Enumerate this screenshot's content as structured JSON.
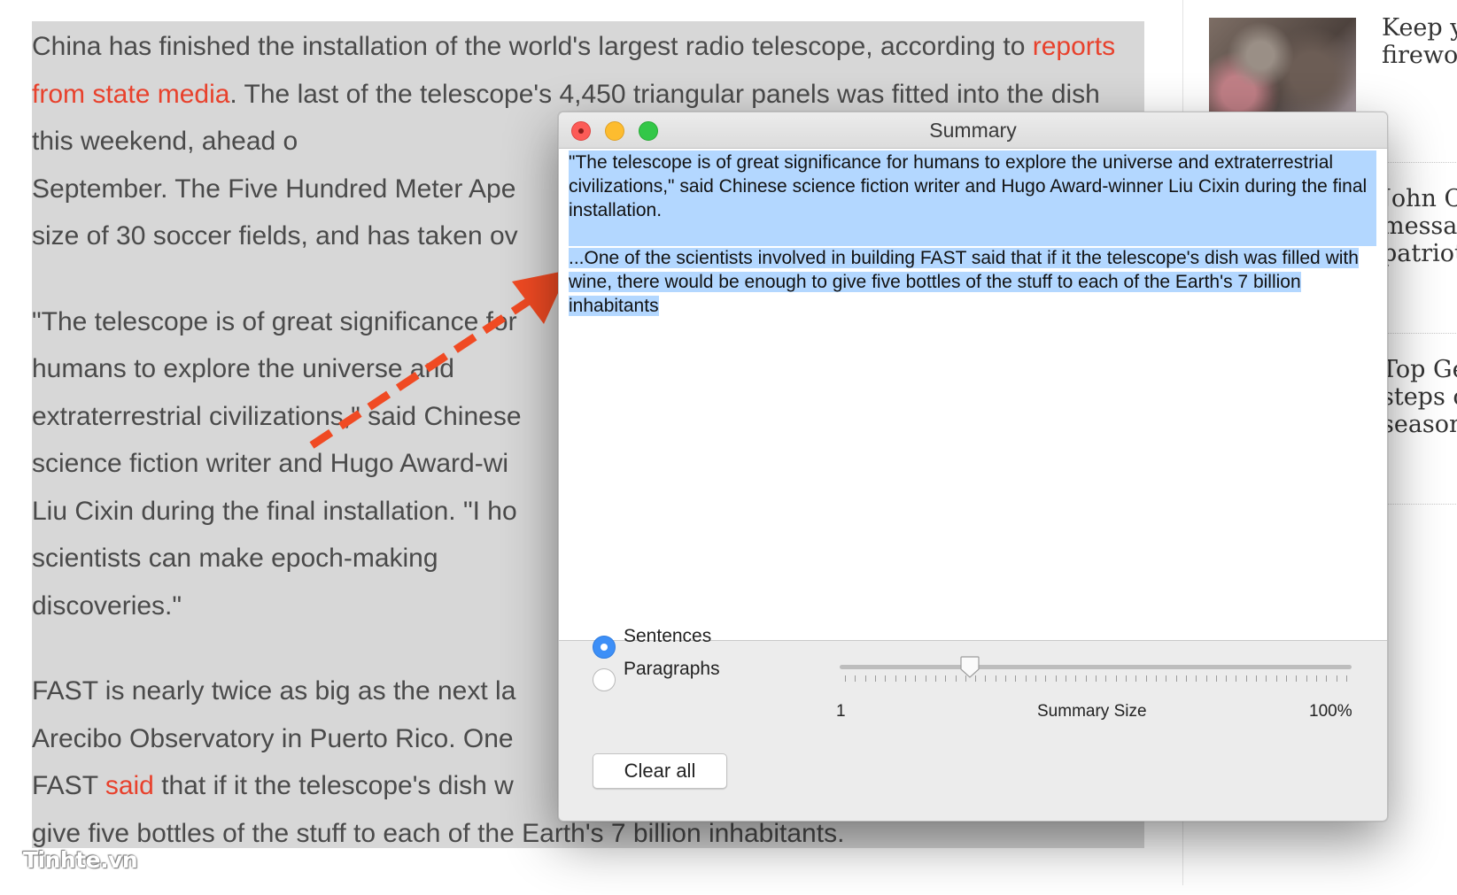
{
  "article": {
    "p1_a": "China has finished the installation of the world's largest radio telescope, according to ",
    "p1_link": "reports from state media",
    "p1_b": ". The last of the telescope's 4,450 triangular panels was fitted into the dish this weekend, ahead o",
    "p1_c": "September. The Five Hundred Meter Ape",
    "p1_d": "size of 30 soccer fields, and has taken ov",
    "p2_lines": [
      "\"The telescope is of great significance for",
      "humans to explore the universe and",
      "extraterrestrial civilizations,\" said Chinese",
      "science fiction writer and Hugo Award-wi",
      "Liu Cixin during the final installation. \"I ho",
      "scientists can make epoch-making",
      "discoveries.\""
    ],
    "p3_a": "FAST is nearly twice as big as the next la",
    "p3_b": "Arecibo Observatory in Puerto Rico. One",
    "p3_c1": "FAST ",
    "p3_link": "said",
    "p3_c2": " that if it the telescope's dish w",
    "p3_d": "give five bottles of the stuff to each of the Earth's 7 billion inhabitants."
  },
  "sidebar": {
    "items": [
      {
        "title_lines": [
          "Keep y",
          "firewo"
        ]
      },
      {
        "title_lines": [
          "John C",
          "messag",
          "patriot"
        ]
      },
      {
        "title_lines": [
          "Top Ge",
          "steps o",
          "season"
        ]
      }
    ]
  },
  "window": {
    "title": "Summary",
    "summary_p1": "\"The telescope is of great significance for humans to explore the universe and extraterrestrial civilizations,\" said Chinese science fiction writer and Hugo Award-winner Liu Cixin during the final installation.",
    "summary_p2": "...One of the scientists involved in building FAST said that if it the telescope's dish was filled with wine, there would be enough to give five bottles of the stuff to each of the Earth's 7 billion inhabitants",
    "radio_sentences": "Sentences",
    "radio_paragraphs": "Paragraphs",
    "selected_mode": "Sentences",
    "slider_min": "1",
    "slider_label": "Summary Size",
    "slider_max": "100%",
    "slider_value_fraction": 0.255,
    "clear_label": "Clear all"
  },
  "colors": {
    "link": "#e8412c",
    "selection": "#b3d7ff",
    "arrow": "#f04a23",
    "radio_on": "#3d8ff7"
  },
  "watermark": "Tinhte.vn"
}
